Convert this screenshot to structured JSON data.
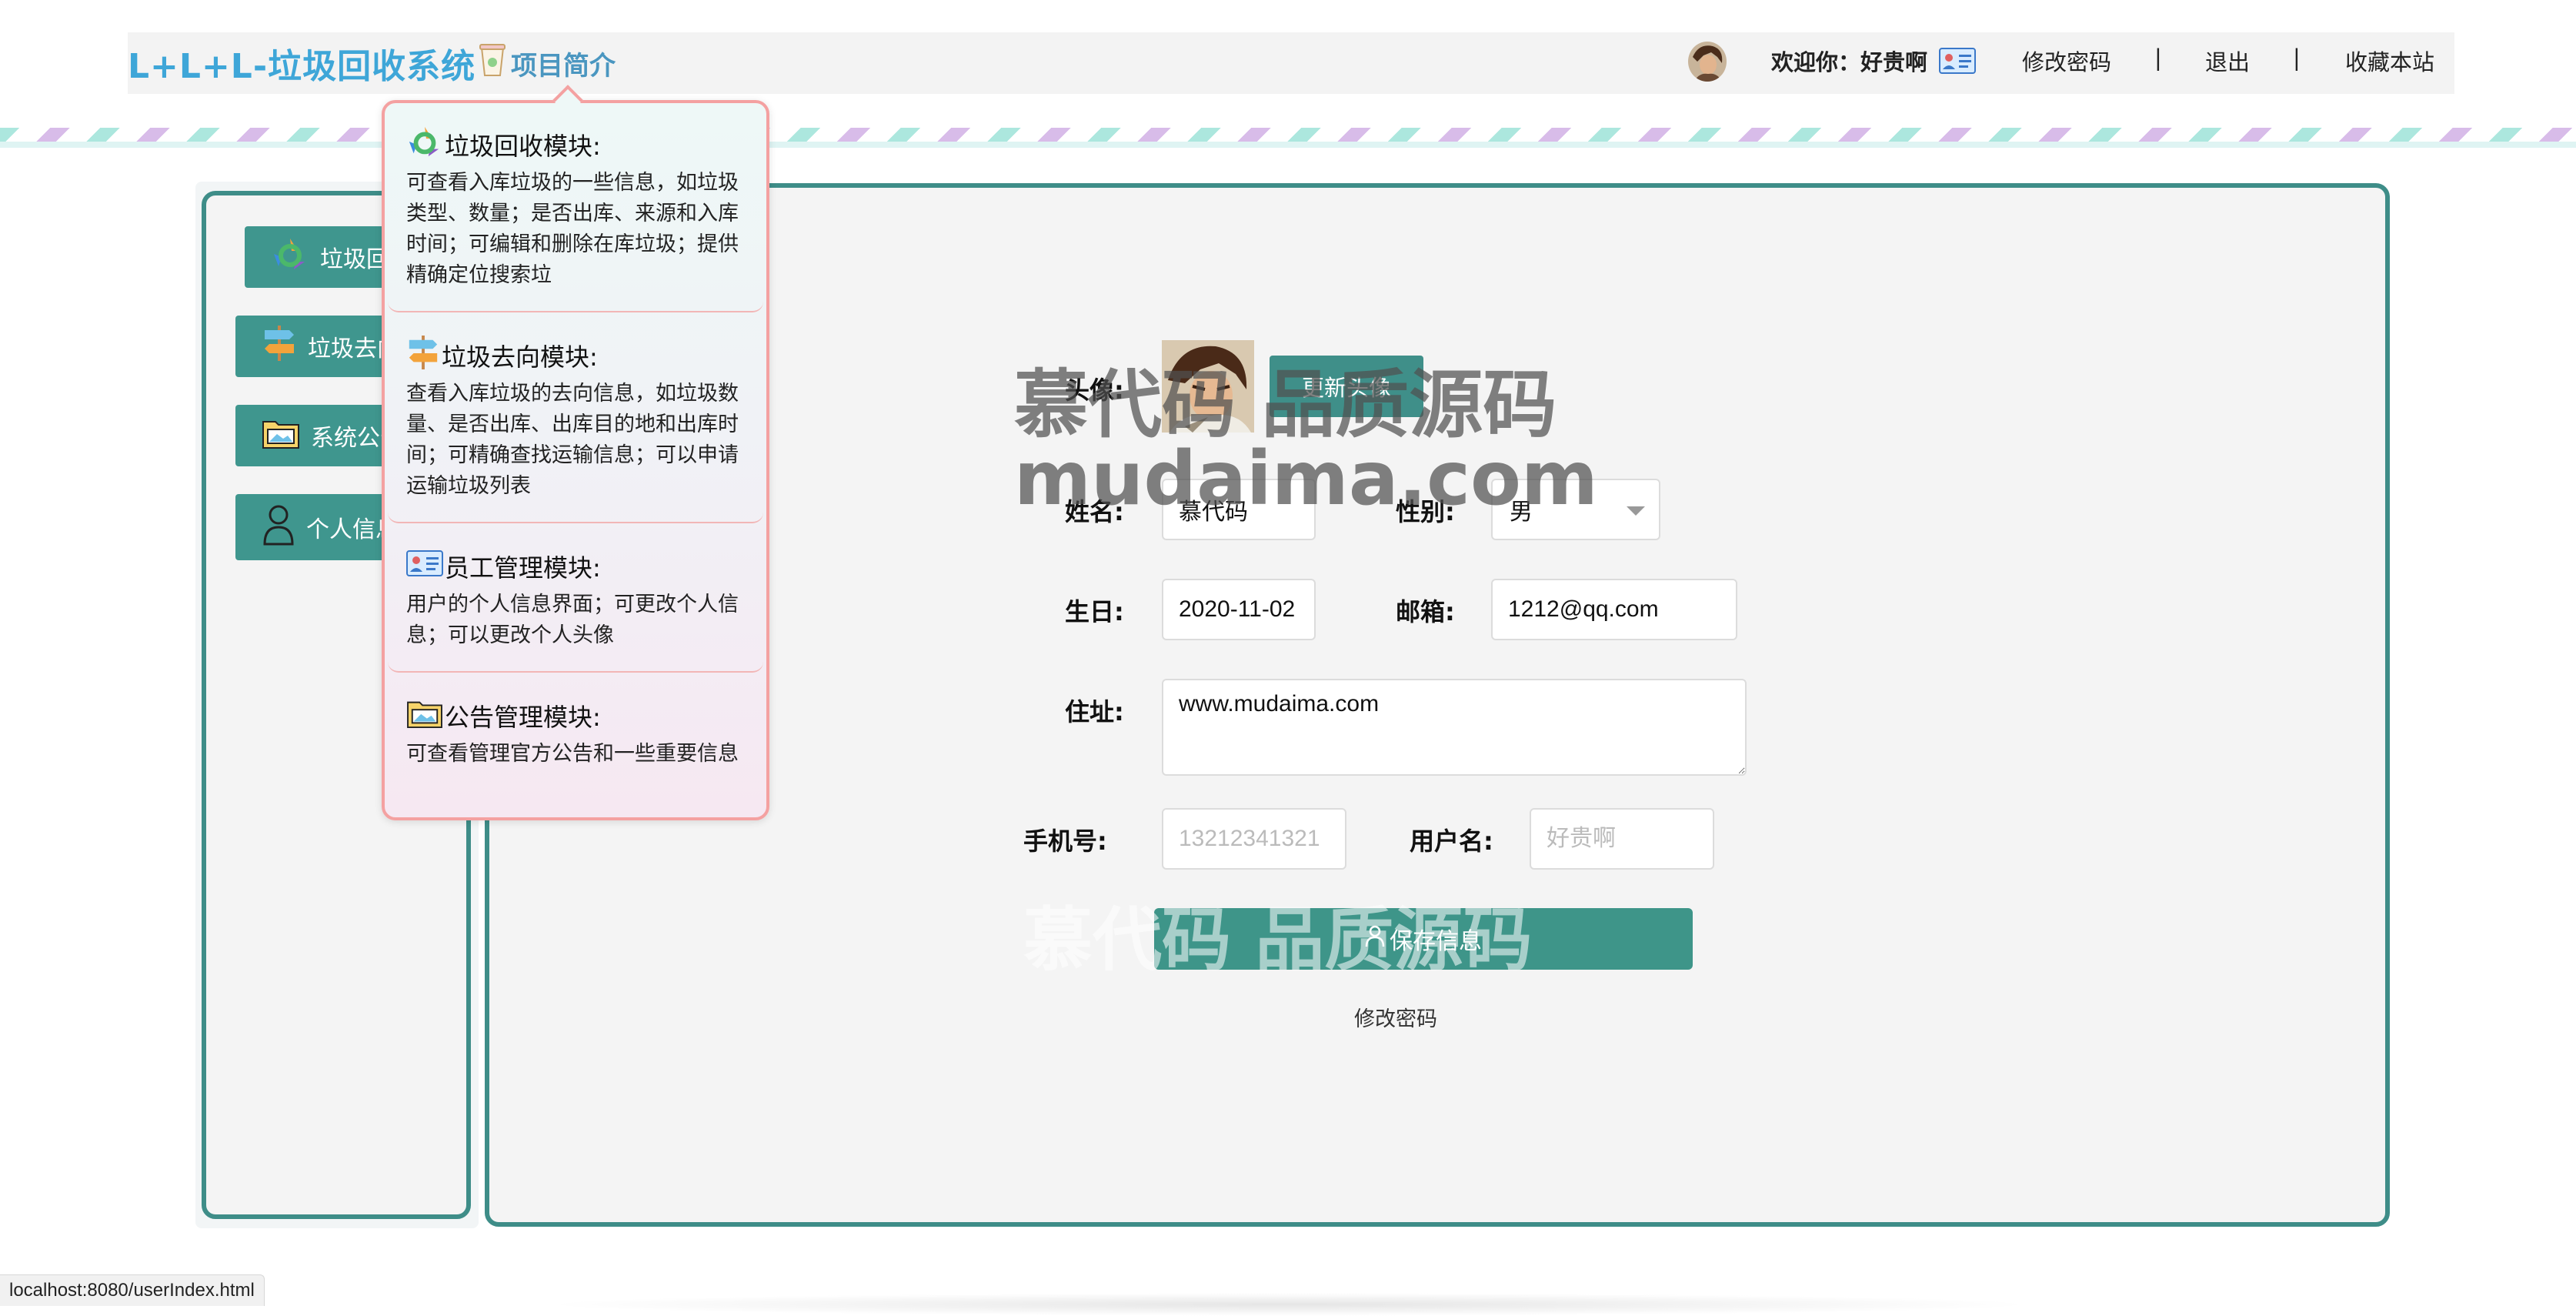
{
  "header": {
    "app_title": "L+L+L-垃圾回收系统",
    "intro_label": "项目简介",
    "welcome": "欢迎你：好贵啊",
    "change_password": "修改密码",
    "separator": "|",
    "logout": "退出",
    "bookmark": "收藏本站"
  },
  "sidebar": {
    "items": [
      {
        "label": "垃圾回收模块",
        "icon": "recycle-icon"
      },
      {
        "label": "垃圾去向模块",
        "icon": "signpost-icon"
      },
      {
        "label": "系统公告模块",
        "icon": "folder-icon"
      },
      {
        "label": "个人信息",
        "icon": "person-icon"
      }
    ]
  },
  "intro_popup": {
    "sections": [
      {
        "title": "垃圾回收模块:",
        "icon": "recycle-icon",
        "desc": "可查看入库垃圾的一些信息，如垃圾类型、数量；是否出库、来源和入库时间；可编辑和删除在库垃圾；提供精确定位搜索垃"
      },
      {
        "title": "垃圾去向模块:",
        "icon": "signpost-icon",
        "desc": "查看入库垃圾的去向信息，如垃圾数量、是否出库、出库目的地和出库时间；可精确查找运输信息；可以申请运输垃圾列表"
      },
      {
        "title": "员工管理模块:",
        "icon": "id-card-icon",
        "desc": "用户的个人信息界面；可更改个人信息；可以更改个人头像"
      },
      {
        "title": "公告管理模块:",
        "icon": "folder-icon",
        "desc": "可查看管理官方公告和一些重要信息"
      }
    ]
  },
  "form": {
    "avatar_label": "头像:",
    "update_avatar": "更新头像",
    "name_label": "姓名:",
    "name_value": "慕代码",
    "gender_label": "性别:",
    "gender_value": "男",
    "birthday_label": "生日:",
    "birthday_value": "2020-11-02",
    "email_label": "邮箱:",
    "email_value": "1212@qq.com",
    "address_label": "住址:",
    "address_value": "www.mudaima.com",
    "phone_label": "手机号:",
    "phone_placeholder": "13212341321",
    "username_label": "用户名:",
    "username_placeholder": "好贵啊",
    "save_button": "保存信息",
    "change_password_link": "修改密码"
  },
  "watermark": {
    "line1": "慕代码 品质源码",
    "line2": "mudaima.com"
  },
  "status_bar": {
    "url": "localhost:8080/userIndex.html"
  },
  "colors": {
    "accent": "#3f968e",
    "title_blue": "#3ea6d8",
    "popup_border": "#f4a1a1"
  }
}
